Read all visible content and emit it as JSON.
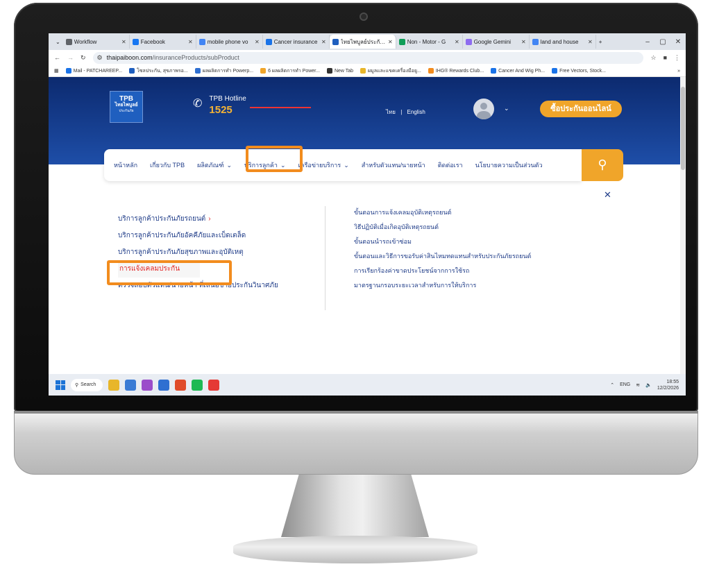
{
  "browser": {
    "tabs": [
      {
        "label": "Workflow",
        "color": "#5f6368",
        "active": false
      },
      {
        "label": "Facebook",
        "color": "#1877f2",
        "active": false
      },
      {
        "label": "mobile phone vo",
        "color": "#4285f4",
        "active": false
      },
      {
        "label": "Cancer insurance",
        "color": "#1a73e8",
        "active": false
      },
      {
        "label": "ไทยไพบูลย์ประกันภั",
        "color": "#1f5fbf",
        "active": true
      },
      {
        "label": "Non - Motor - G",
        "color": "#0f9d58",
        "active": false
      },
      {
        "label": "Google Gemini",
        "color": "#8e6cf0",
        "active": false
      },
      {
        "label": "land and house",
        "color": "#4285f4",
        "active": false
      }
    ],
    "new_tab": "+",
    "window_controls": [
      "–",
      "▢",
      "✕"
    ],
    "url_host": "thaipaiboon.com",
    "url_path": "/insuranceProducts/subProduct",
    "bookmarks": [
      "Mail - PATCHAREEP...",
      "โซลประกัน, สุขภาพรอ...",
      "ผลผลิตการทำ Powerp...",
      "6 ผลผลิตการทำ Power...",
      "New Tab",
      "ผมูลและแขคเครื่องมือยู...",
      "IHG® Rewards Club...",
      "Cancer And Wig Ph...",
      "Free Vectors, Stock..."
    ]
  },
  "site": {
    "logo_line1": "TPB",
    "logo_line2": "ไทยไพบูลย์",
    "logo_line3": "ประกันภัย",
    "hotline_label": "TPB Hotline",
    "hotline_number": "1525",
    "lang_th": "ไทย",
    "lang_sep": "|",
    "lang_en": "English",
    "buy_button": "ซื้อประกันออนไลน์",
    "nav": [
      {
        "label": "หน้าหลัก",
        "chevron": false
      },
      {
        "label": "เกี่ยวกับ TPB",
        "chevron": false
      },
      {
        "label": "ผลิตภัณฑ์",
        "chevron": true
      },
      {
        "label": "บริการลูกค้า",
        "chevron": true
      },
      {
        "label": "เครือข่ายบริการ",
        "chevron": true
      },
      {
        "label": "สำหรับตัวแทน/นายหน้า",
        "chevron": false
      },
      {
        "label": "ติดต่อเรา",
        "chevron": false
      },
      {
        "label": "นโยบายความเป็นส่วนตัว",
        "chevron": false
      }
    ],
    "close_symbol": "✕",
    "menu_left": [
      {
        "label": "บริการลูกค้าประกันภัยรถยนต์",
        "arrow": "›",
        "selected": false
      },
      {
        "label": "บริการลูกค้าประกันภัยอัคคีภัยและเบ็ดเตล็ด",
        "arrow": "",
        "selected": false
      },
      {
        "label": "บริการลูกค้าประกันภัยสุขภาพและอุบัติเหตุ",
        "arrow": "",
        "selected": false
      },
      {
        "label": "การแจ้งเคลมประกัน",
        "arrow": "",
        "selected": true
      },
      {
        "label": "ตรวจสอบตัวแทน/นายหน้า ที่เสนอขายประกันวินาศภัย",
        "arrow": "",
        "selected": false
      }
    ],
    "menu_right": [
      "ขั้นตอนการแจ้งเคลมอุบัติเหตุรถยนต์",
      "วิธีปฏิบัติเมื่อเกิดอุบัติเหตุรถยนต์",
      "ขั้นตอนนำรถเข้าซ่อม",
      "ขั้นตอนและวิธีการขอรับค่าสินไหมทดแทนสำหรับประกันภัยรถยนต์",
      "การเรียกร้องค่าขาดประโยชน์จากการใช้รถ",
      "มาตรฐานกรอบระยะเวลาสำหรับการให้บริการ"
    ]
  },
  "taskbar": {
    "search_label": "Search",
    "apps": [
      "#e8b62a",
      "#3a7bd5",
      "#9b4dca",
      "#2f6fd1",
      "#e04c2a",
      "#1db954",
      "#e53935"
    ],
    "tray_lang": "ENG",
    "time": "18:55",
    "date": "12/2/2026"
  },
  "colors": {
    "accent_orange": "#f0a52a",
    "highlight_orange": "#f28c1e",
    "brand_blue": "#1f3c88",
    "selected_red": "#e02424"
  }
}
